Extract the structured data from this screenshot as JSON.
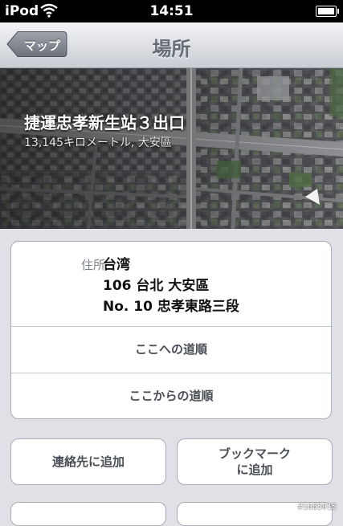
{
  "status_bar": {
    "carrier": "iPod",
    "time": "14:51"
  },
  "nav": {
    "back_label": "マップ",
    "title": "場所"
  },
  "place": {
    "name": "捷運忠孝新生站３出口",
    "subtitle": "13,145キロメートル, 大安區"
  },
  "address": {
    "label": "住所",
    "line1": "台湾",
    "line2": "106 台北 大安區",
    "line3": "No. 10 忠孝東路三段"
  },
  "directions": {
    "to_here": "ここへの道順",
    "from_here": "ここからの道順"
  },
  "actions": {
    "add_contact": "連絡先に追加",
    "bookmark_line1": "ブックマーク",
    "bookmark_line2": "に追加"
  },
  "watermark": "#1685015"
}
